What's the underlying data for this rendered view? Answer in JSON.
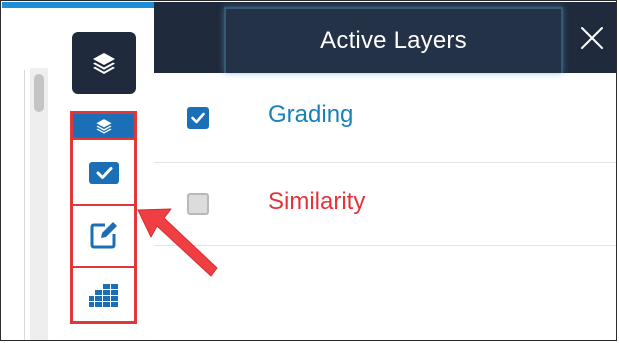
{
  "panel": {
    "title": "Active Layers",
    "close_icon": "close-icon"
  },
  "layers": [
    {
      "name": "Grading",
      "checked": true,
      "color": "#1a80b8"
    },
    {
      "name": "Similarity",
      "checked": false,
      "color": "#e5333a"
    }
  ],
  "toolbar": {
    "layers_toggle_icon": "layers-icon",
    "tools": [
      {
        "icon": "layers-icon",
        "active": true
      },
      {
        "icon": "checkbox-icon",
        "active": false
      },
      {
        "icon": "edit-icon",
        "active": false
      },
      {
        "icon": "grid-icon",
        "active": false
      }
    ]
  },
  "colors": {
    "header_bg": "#1f2a3c",
    "accent_blue": "#1a6fb6",
    "highlight_red": "#e0383a",
    "top_accent": "#1e8fd6"
  }
}
